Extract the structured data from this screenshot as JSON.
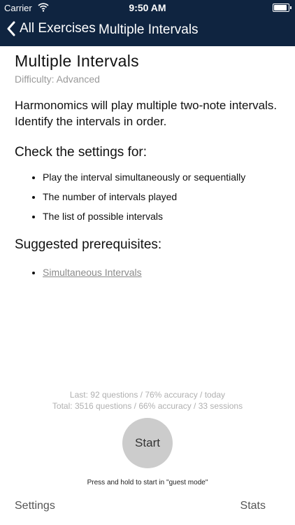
{
  "status_bar": {
    "carrier": "Carrier",
    "time": "9:50 AM",
    "wifi_icon": "wifi-icon",
    "battery_icon": "battery-icon"
  },
  "nav": {
    "back_label": "All Exercises",
    "title": "Multiple Intervals",
    "back_icon": "chevron-left-icon"
  },
  "exercise": {
    "title": "Multiple Intervals",
    "difficulty": "Difficulty: Advanced",
    "description": "Harmonomics will play multiple two-note intervals. Identify the intervals in order.",
    "settings_heading": "Check the settings for:",
    "settings_items": [
      "Play the interval simultaneously or sequentially",
      "The number of intervals played",
      "The list of possible intervals"
    ],
    "prereq_heading": "Suggested prerequisites:",
    "prereq_items": [
      "Simultaneous Intervals"
    ]
  },
  "stats": {
    "last": "Last: 92 questions / 76% accuracy / today",
    "total": "Total: 3516 questions / 66% accuracy / 33 sessions"
  },
  "start_label": "Start",
  "hint": "Press and hold to start in \"guest mode\"",
  "footer": {
    "settings_label": "Settings",
    "stats_label": "Stats"
  },
  "colors": {
    "header_bg": "#0f2440",
    "start_button": "#cccccc"
  }
}
